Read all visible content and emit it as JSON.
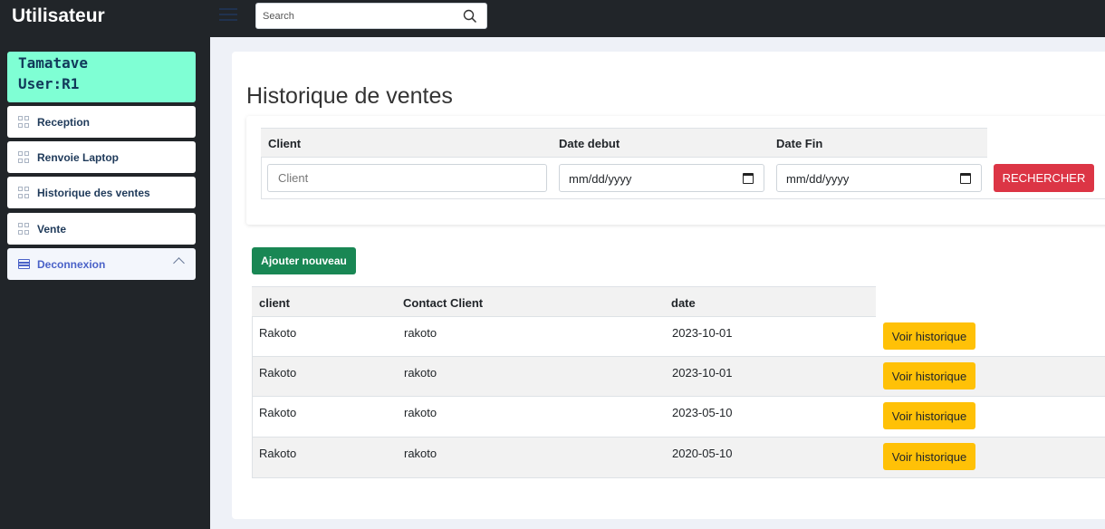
{
  "app": {
    "title": "Utilisateur"
  },
  "search": {
    "placeholder": "Search"
  },
  "user": {
    "line1": "Tamatave",
    "line2": "User:R1"
  },
  "sidebar": {
    "items": [
      {
        "label": "Reception"
      },
      {
        "label": "Renvoie Laptop"
      },
      {
        "label": "Historique des ventes"
      },
      {
        "label": "Vente"
      },
      {
        "label": "Deconnexion"
      }
    ]
  },
  "page": {
    "title": "Historique de ventes"
  },
  "filter": {
    "headers": {
      "client": "Client",
      "date_debut": "Date debut",
      "date_fin": "Date Fin"
    },
    "client_placeholder": "Client",
    "date_debut_value": "mm/dd/yyyy",
    "date_fin_value": "mm/dd/yyyy",
    "search_button": "RECHERCHER"
  },
  "add_button": "Ajouter nouveau",
  "table": {
    "headers": {
      "client": "client",
      "contact": "Contact Client",
      "date": "date"
    },
    "rows": [
      {
        "client": "Rakoto",
        "contact": "rakoto",
        "date": "2023-10-01",
        "action": "Voir historique"
      },
      {
        "client": "Rakoto",
        "contact": "rakoto",
        "date": "2023-10-01",
        "action": "Voir historique"
      },
      {
        "client": "Rakoto",
        "contact": "rakoto",
        "date": "2023-05-10",
        "action": "Voir historique"
      },
      {
        "client": "Rakoto",
        "contact": "rakoto",
        "date": "2020-05-10",
        "action": "Voir historique"
      }
    ]
  },
  "colors": {
    "topbar": "#212529",
    "user_box": "#7fffd4",
    "danger": "#dc3545",
    "success": "#198754",
    "warning": "#ffc107"
  }
}
